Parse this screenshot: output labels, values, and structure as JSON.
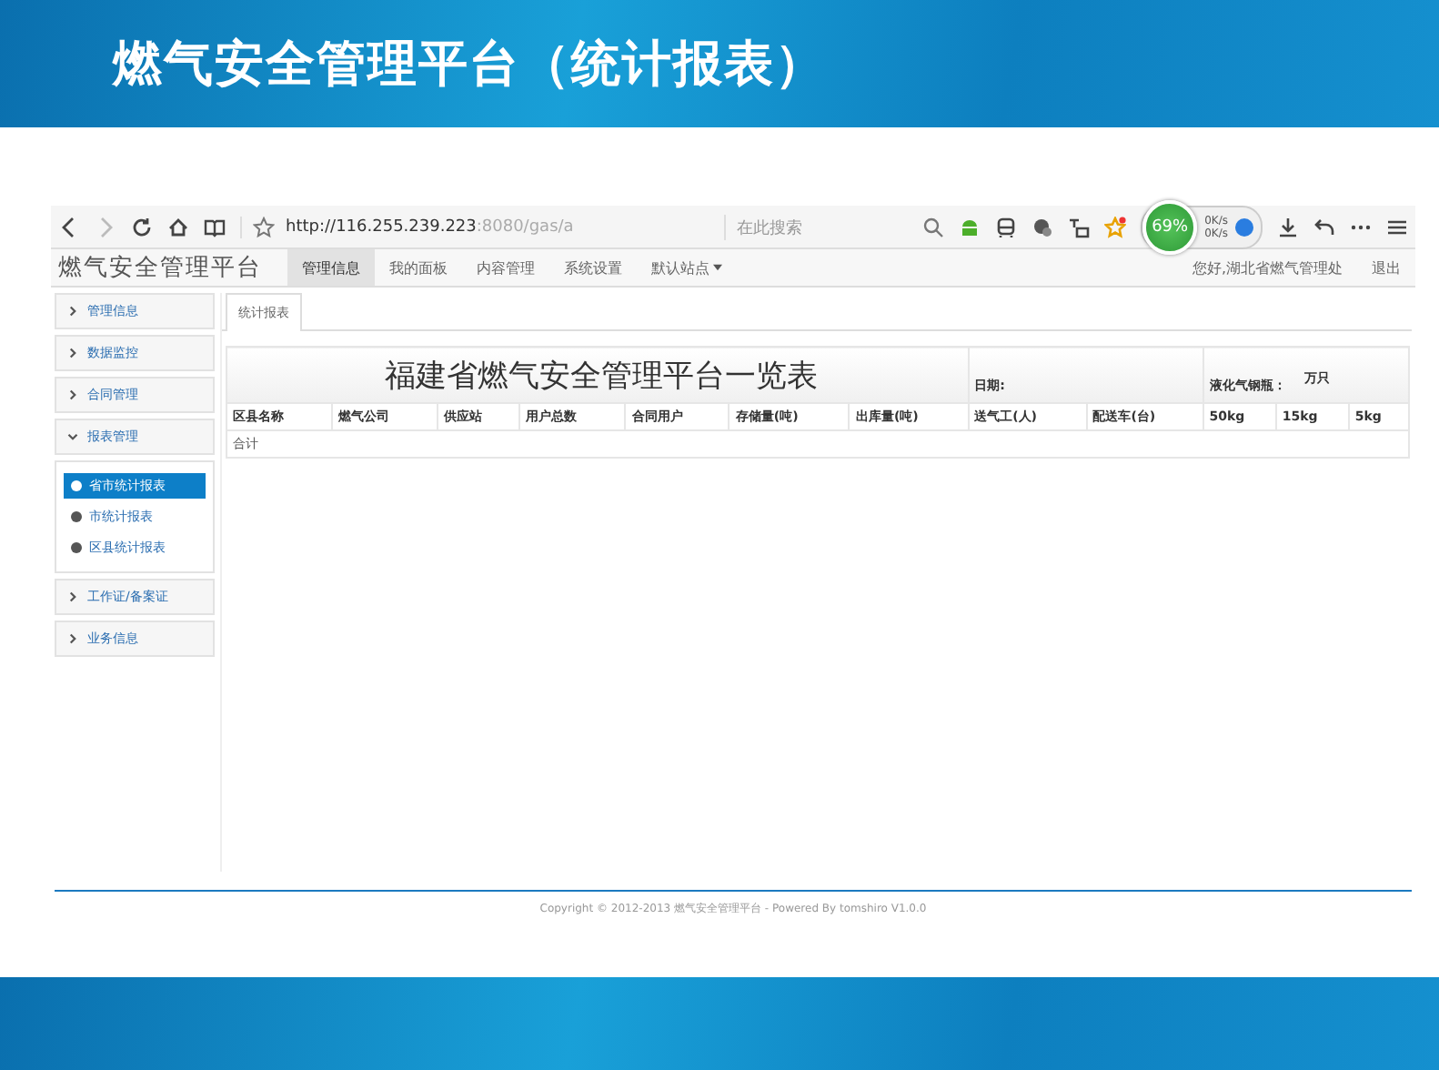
{
  "slide": {
    "title": "燃气安全管理平台（统计报表）"
  },
  "browser": {
    "url_host": "http://116.255.239.223",
    "url_rest": ":8080/gas/a",
    "search_placeholder": "在此搜索",
    "widget": {
      "percent": "69%",
      "up": "0K/s",
      "down": "0K/s"
    }
  },
  "app": {
    "logo": "燃气安全管理平台",
    "nav": [
      {
        "label": "管理信息",
        "selected": true
      },
      {
        "label": "我的面板",
        "selected": false
      },
      {
        "label": "内容管理",
        "selected": false
      },
      {
        "label": "系统设置",
        "selected": false
      }
    ],
    "site_dropdown": "默认站点",
    "greeting": "您好,湖北省燃气管理处",
    "logout": "退出"
  },
  "sidebar": {
    "items": [
      {
        "label": "管理信息",
        "expanded": false
      },
      {
        "label": "数据监控",
        "expanded": false
      },
      {
        "label": "合同管理",
        "expanded": false
      },
      {
        "label": "报表管理",
        "expanded": true,
        "children": [
          {
            "label": "省市统计报表",
            "selected": true
          },
          {
            "label": "市统计报表",
            "selected": false
          },
          {
            "label": "区县统计报表",
            "selected": false
          }
        ]
      },
      {
        "label": "工作证/备案证",
        "expanded": false
      },
      {
        "label": "业务信息",
        "expanded": false
      }
    ]
  },
  "tabs": [
    {
      "label": "统计报表",
      "selected": true
    }
  ],
  "table": {
    "title": "福建省燃气安全管理平台一览表",
    "date_label": "日期:",
    "lpg_label": "液化气钢瓶：",
    "lpg_unit": "万只",
    "columns": [
      "区县名称",
      "燃气公司",
      "供应站",
      "用户总数",
      "合同用户",
      "存储量(吨)",
      "出库量(吨)",
      "送气工(人)",
      "配送车(台)",
      "50kg",
      "15kg",
      "5kg"
    ],
    "total_row": "合计"
  },
  "footer": {
    "copyright": "Copyright © 2012-2013 燃气安全管理平台  - Powered By tomshiro V1.0.0"
  }
}
